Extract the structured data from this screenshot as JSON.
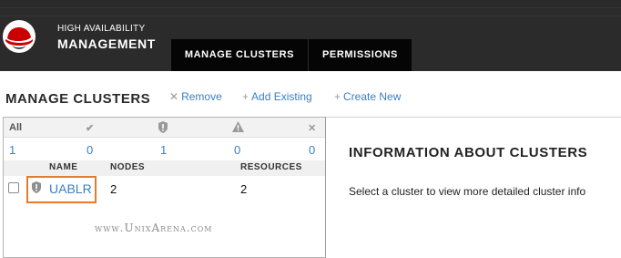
{
  "header": {
    "product_line1": "HIGH AVAILABILITY",
    "product_line2": "MANAGEMENT",
    "tabs": [
      {
        "label": "MANAGE CLUSTERS"
      },
      {
        "label": "PERMISSIONS"
      }
    ],
    "colors": {
      "bar": "#2b2b2b",
      "tab": "#050505",
      "logo_red": "#cc0000"
    }
  },
  "page": {
    "title": "MANAGE CLUSTERS",
    "actions": [
      {
        "prefix": "✕",
        "label": "Remove"
      },
      {
        "prefix": "+",
        "label": "Add Existing"
      },
      {
        "prefix": "+",
        "label": "Create New"
      }
    ]
  },
  "cluster_list": {
    "filters": [
      {
        "label": "All",
        "icon": "all-filter"
      },
      {
        "label": "✔",
        "icon": "ok-icon"
      },
      {
        "label": "shield",
        "icon": "shield-icon"
      },
      {
        "label": "warning",
        "icon": "warning-icon"
      },
      {
        "label": "✕",
        "icon": "error-icon"
      }
    ],
    "counts": [
      "1",
      "0",
      "1",
      "0",
      "0"
    ],
    "columns": [
      "NAME",
      "NODES",
      "RESOURCES"
    ],
    "rows": [
      {
        "name": "UABLR",
        "nodes": "2",
        "resources": "2",
        "status_icon": "shield-icon"
      }
    ],
    "highlight_color": "#e77b2b"
  },
  "watermark": "www.UnixArena.com",
  "info_panel": {
    "title": "INFORMATION ABOUT CLUSTERS",
    "text": "Select a cluster to view more detailed cluster info"
  }
}
